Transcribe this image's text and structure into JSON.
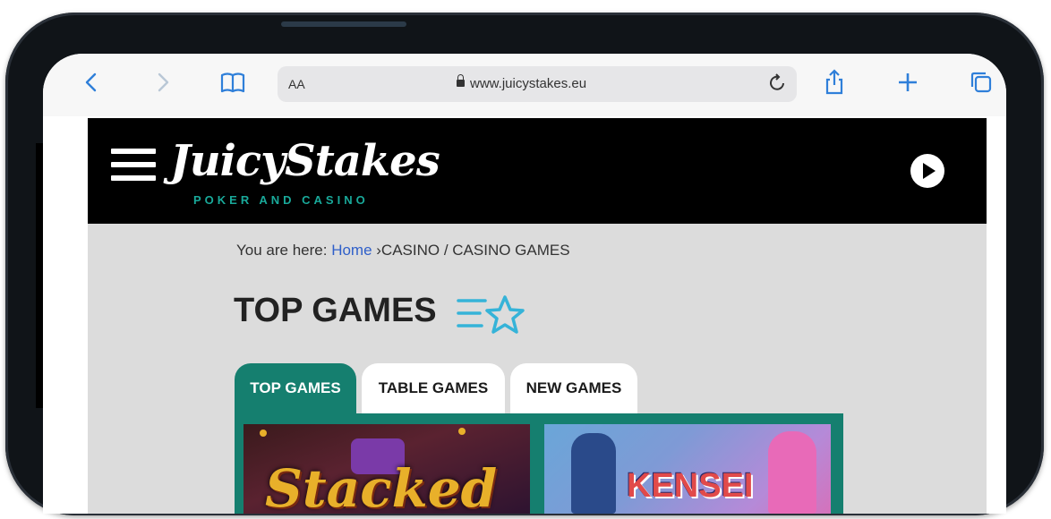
{
  "browser": {
    "aa_label": "AA",
    "url": "www.juicystakes.eu"
  },
  "site": {
    "logo_main": "JuicyStakes",
    "logo_sub": "POKER AND CASINO"
  },
  "breadcrumb": {
    "prefix": "You are here: ",
    "home": "Home",
    "rest": " ›CASINO / CASINO GAMES"
  },
  "page": {
    "title": "TOP GAMES"
  },
  "tabs": [
    {
      "label": "TOP GAMES",
      "active": true
    },
    {
      "label": "TABLE GAMES",
      "active": false
    },
    {
      "label": "NEW GAMES",
      "active": false
    }
  ],
  "games": [
    {
      "title": "Stacked"
    },
    {
      "title": "KENSEI"
    }
  ],
  "colors": {
    "brand_green": "#157f6f",
    "safari_blue": "#2f7fd9",
    "breadcrumb_link": "#2f5fc9"
  },
  "icons": [
    "back-icon",
    "forward-icon",
    "bookmarks-icon",
    "lock-icon",
    "reload-icon",
    "share-icon",
    "new-tab-icon",
    "tabs-icon",
    "menu-icon",
    "play-icon",
    "star-lines-icon"
  ]
}
